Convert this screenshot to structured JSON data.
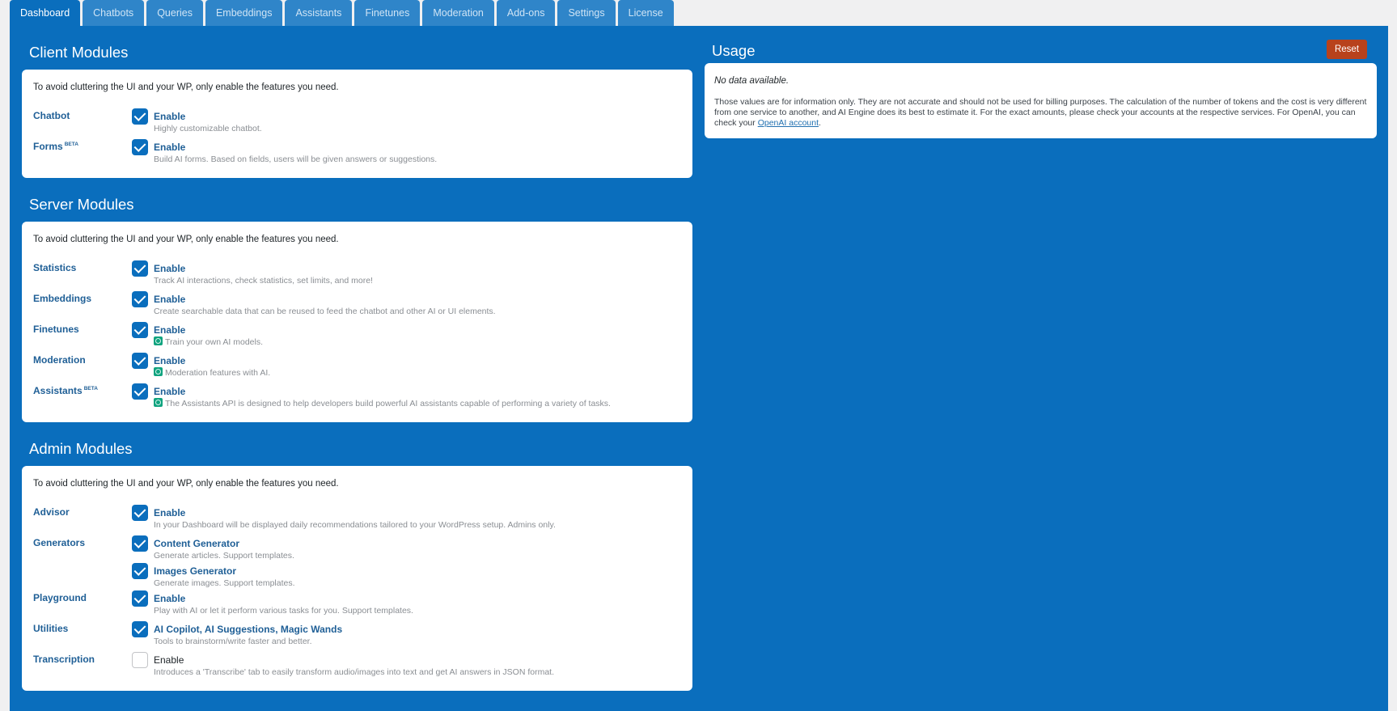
{
  "tabs": [
    "Dashboard",
    "Chatbots",
    "Queries",
    "Embeddings",
    "Assistants",
    "Finetunes",
    "Moderation",
    "Add-ons",
    "Settings",
    "License"
  ],
  "client": {
    "title": "Client Modules",
    "intro": "To avoid cluttering the UI and your WP, only enable the features you need.",
    "modules": [
      {
        "label": "Chatbot",
        "beta": "",
        "options": [
          {
            "title": "Enable",
            "desc": "Highly customizable chatbot.",
            "checked": true,
            "openai": false
          }
        ]
      },
      {
        "label": "Forms",
        "beta": "BETA",
        "options": [
          {
            "title": "Enable",
            "desc": "Build AI forms. Based on fields, users will be given answers or suggestions.",
            "checked": true,
            "openai": false
          }
        ]
      }
    ]
  },
  "server": {
    "title": "Server Modules",
    "intro": "To avoid cluttering the UI and your WP, only enable the features you need.",
    "modules": [
      {
        "label": "Statistics",
        "beta": "",
        "options": [
          {
            "title": "Enable",
            "desc": "Track AI interactions, check statistics, set limits, and more!",
            "checked": true,
            "openai": false
          }
        ]
      },
      {
        "label": "Embeddings",
        "beta": "",
        "options": [
          {
            "title": "Enable",
            "desc": "Create searchable data that can be reused to feed the chatbot and other AI or UI elements.",
            "checked": true,
            "openai": false
          }
        ]
      },
      {
        "label": "Finetunes",
        "beta": "",
        "options": [
          {
            "title": "Enable",
            "desc": "Train your own AI models.",
            "checked": true,
            "openai": true
          }
        ]
      },
      {
        "label": "Moderation",
        "beta": "",
        "options": [
          {
            "title": "Enable",
            "desc": "Moderation features with AI.",
            "checked": true,
            "openai": true
          }
        ]
      },
      {
        "label": "Assistants",
        "beta": "BETA",
        "options": [
          {
            "title": "Enable",
            "desc": "The Assistants API is designed to help developers build powerful AI assistants capable of performing a variety of tasks.",
            "checked": true,
            "openai": true
          }
        ]
      }
    ]
  },
  "admin": {
    "title": "Admin Modules",
    "intro": "To avoid cluttering the UI and your WP, only enable the features you need.",
    "modules": [
      {
        "label": "Advisor",
        "beta": "",
        "options": [
          {
            "title": "Enable",
            "desc": "In your Dashboard will be displayed daily recommendations tailored to your WordPress setup. Admins only.",
            "checked": true,
            "openai": false
          }
        ]
      },
      {
        "label": "Generators",
        "beta": "",
        "options": [
          {
            "title": "Content Generator",
            "desc": "Generate articles. Support templates.",
            "checked": true,
            "openai": false
          },
          {
            "title": "Images Generator",
            "desc": "Generate images. Support templates.",
            "checked": true,
            "openai": false
          }
        ]
      },
      {
        "label": "Playground",
        "beta": "",
        "options": [
          {
            "title": "Enable",
            "desc": "Play with AI or let it perform various tasks for you. Support templates.",
            "checked": true,
            "openai": false
          }
        ]
      },
      {
        "label": "Utilities",
        "beta": "",
        "options": [
          {
            "title": "AI Copilot, AI Suggestions, Magic Wands",
            "desc": "Tools to brainstorm/write faster and better.",
            "checked": true,
            "openai": false
          }
        ]
      },
      {
        "label": "Transcription",
        "beta": "",
        "options": [
          {
            "title": "Enable",
            "desc": "Introduces a 'Transcribe' tab to easily transform audio/images into text and get AI answers in JSON format.",
            "checked": false,
            "openai": false
          }
        ]
      }
    ]
  },
  "usage": {
    "title": "Usage",
    "reset_label": "Reset",
    "no_data": "No data available.",
    "note": "Those values are for information only. They are not accurate and should not be used for billing purposes. The calculation of the number of tokens and the cost is very different from one service to another, and AI Engine does its best to estimate it. For the exact amounts, please check your accounts at the respective services. For OpenAI, you can check your ",
    "link_text": "OpenAI account",
    "note_end": "."
  },
  "colors": {
    "accent": "#0a6ebd",
    "reset": "#b8421c",
    "openai_icon": "#10a37f"
  },
  "icons": {
    "check": "checkmark-icon",
    "openai": "openai-logo-icon"
  }
}
